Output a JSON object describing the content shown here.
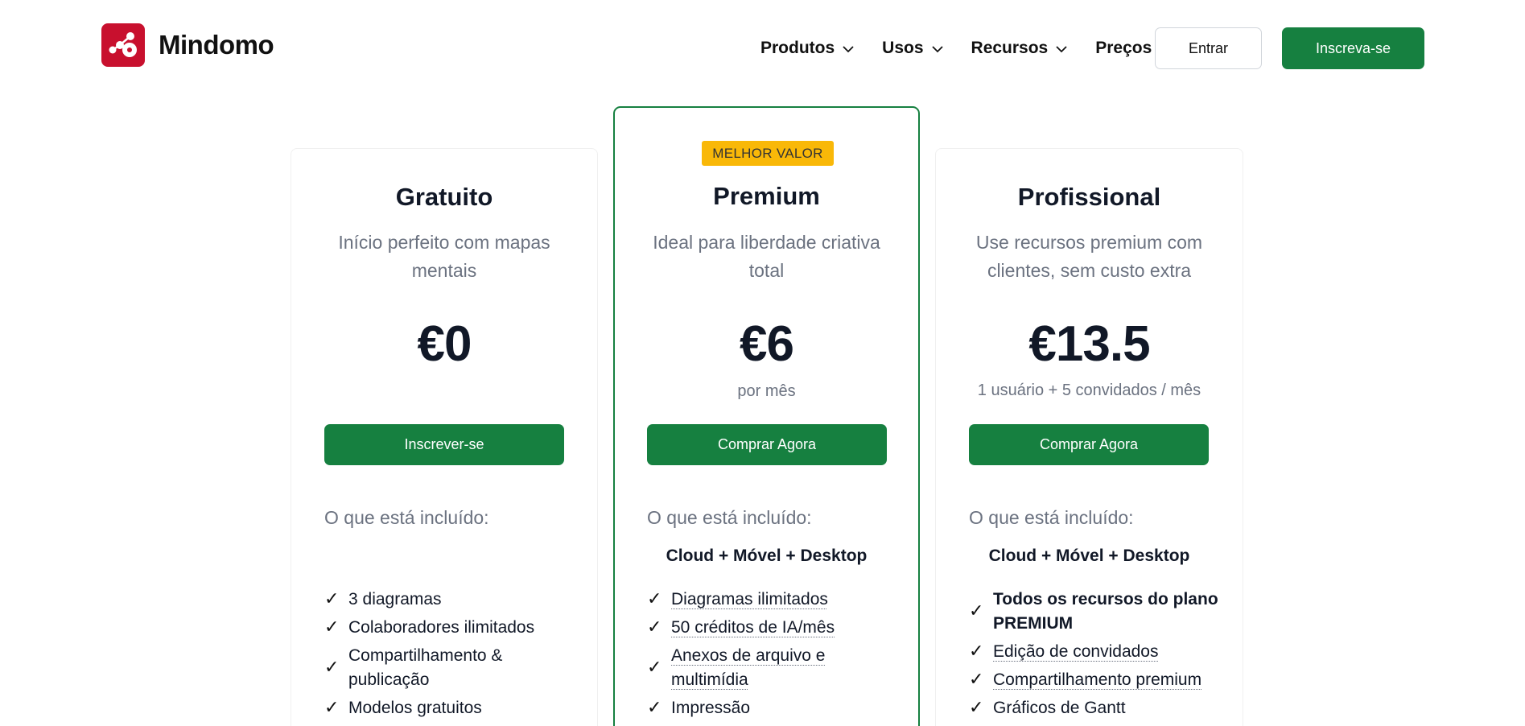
{
  "header": {
    "logo_text": "Mindomo",
    "nav": [
      {
        "label": "Produtos",
        "has_dropdown": true
      },
      {
        "label": "Usos",
        "has_dropdown": true
      },
      {
        "label": "Recursos",
        "has_dropdown": true
      },
      {
        "label": "Preços",
        "has_dropdown": false
      }
    ],
    "login_label": "Entrar",
    "signup_label": "Inscreva-se"
  },
  "colors": {
    "brand_green": "#168040",
    "badge_yellow": "#f9b808",
    "logo_red": "#c8102e"
  },
  "plans": [
    {
      "name": "Gratuito",
      "description": "Início perfeito com mapas mentais",
      "price": "€0",
      "period": "",
      "cta": "Inscrever-se",
      "included_label": "O que está incluído:",
      "features": [
        {
          "text": "3 diagramas"
        },
        {
          "text": "Colaboradores ilimitados"
        },
        {
          "text": "Compartilhamento & publicação"
        },
        {
          "text": "Modelos gratuitos"
        }
      ]
    },
    {
      "badge": "MELHOR VALOR",
      "name": "Premium",
      "description": "Ideal para liberdade criativa total",
      "price": "€6",
      "period": "por mês",
      "cta": "Comprar Agora",
      "included_label": "O que está incluído:",
      "platforms": "Cloud + Móvel + Desktop",
      "features": [
        {
          "text": "Diagramas ilimitados"
        },
        {
          "text": "50 créditos de IA/mês"
        },
        {
          "text": "Anexos de arquivo e multimídia"
        },
        {
          "text": "Impressão"
        }
      ]
    },
    {
      "name": "Profissional",
      "description": "Use recursos premium com clientes, sem custo extra",
      "price": "€13.5",
      "period": "1 usuário + 5 convidados / mês",
      "cta": "Comprar Agora",
      "included_label": "O que está incluído:",
      "platforms": "Cloud + Móvel + Desktop",
      "features": [
        {
          "text": "Todos os recursos do plano PREMIUM"
        },
        {
          "text": "Edição de convidados"
        },
        {
          "text": "Compartilhamento premium"
        },
        {
          "text": "Gráficos de Gantt"
        }
      ]
    }
  ],
  "check_glyph": "✓"
}
